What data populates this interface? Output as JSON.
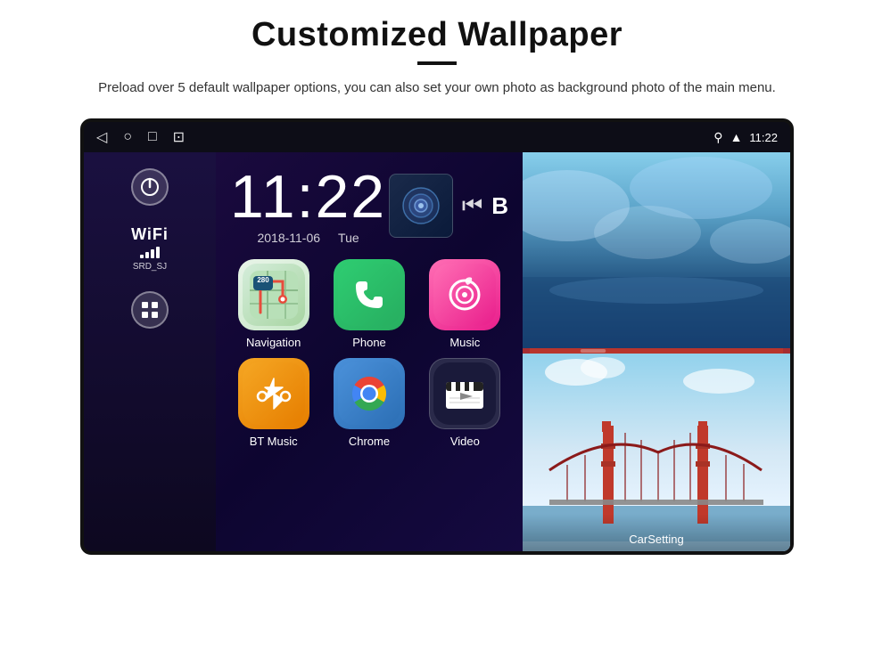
{
  "header": {
    "title": "Customized Wallpaper",
    "subtitle": "Preload over 5 default wallpaper options, you can also set your own photo as background photo of the main menu."
  },
  "device": {
    "statusBar": {
      "time": "11:22",
      "navIcons": [
        "◁",
        "○",
        "□",
        "⊡"
      ]
    },
    "clock": {
      "time": "11:22",
      "date": "2018-11-06",
      "day": "Tue"
    },
    "wifi": {
      "label": "WiFi",
      "ssid": "SRD_SJ"
    },
    "apps": [
      {
        "label": "Navigation",
        "type": "navigation"
      },
      {
        "label": "Phone",
        "type": "phone"
      },
      {
        "label": "Music",
        "type": "music"
      },
      {
        "label": "BT Music",
        "type": "btmusic"
      },
      {
        "label": "Chrome",
        "type": "chrome"
      },
      {
        "label": "Video",
        "type": "video"
      }
    ],
    "rightPanel": {
      "carSettingLabel": "CarSetting"
    }
  }
}
